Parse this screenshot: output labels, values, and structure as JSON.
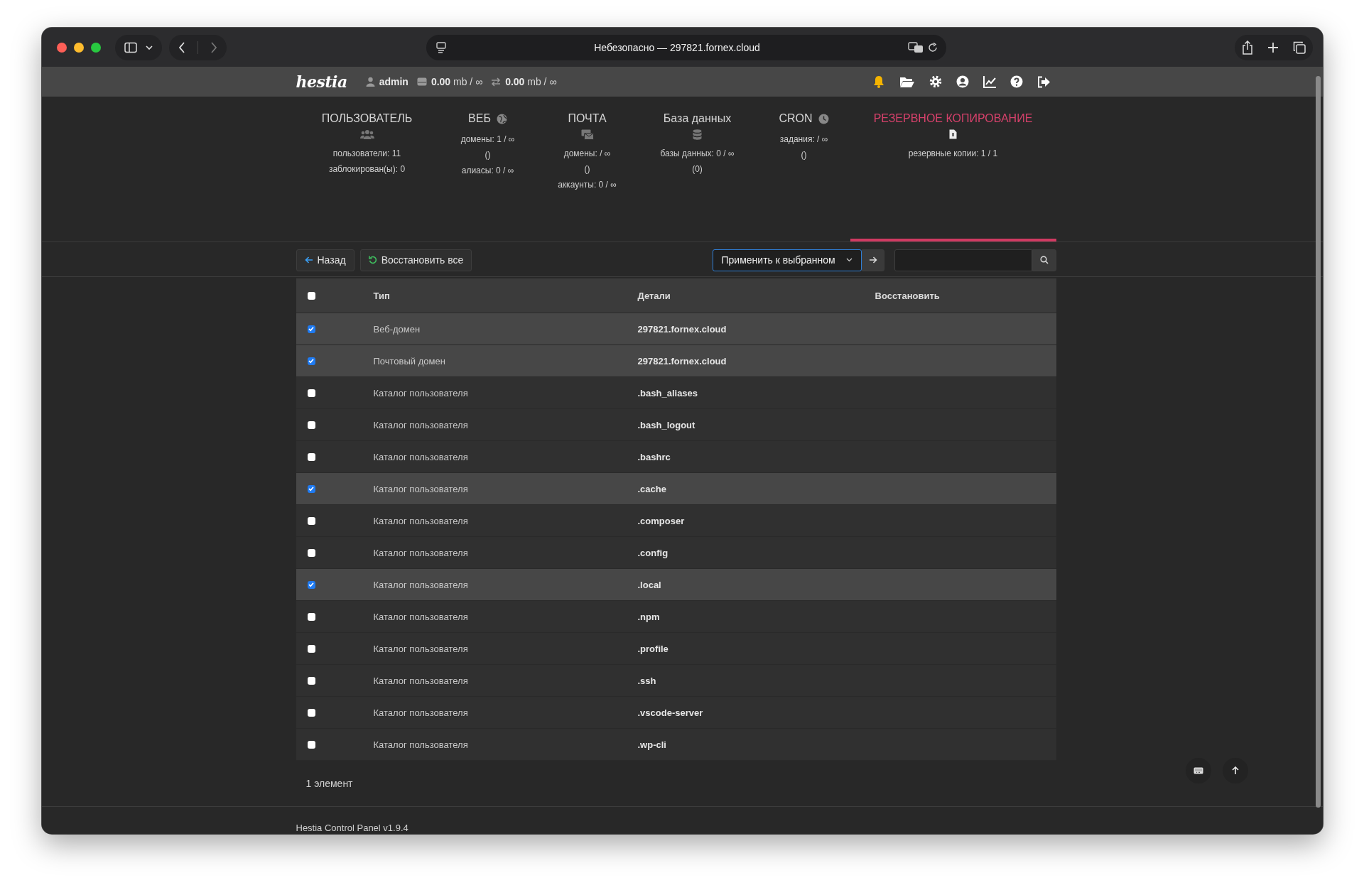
{
  "browser": {
    "address": "Небезопасно — 297821.fornex.cloud"
  },
  "topbar": {
    "logo": "hestia",
    "user": "admin",
    "disk": "**0.00** mb / ∞",
    "bandwidth": "**0.00** mb / ∞"
  },
  "stats": [
    {
      "title": "ПОЛЬЗОВАТЕЛЬ",
      "kind": "below",
      "selected": false,
      "lines": [
        "пользователи: 11",
        "заблокирован(ы): 0"
      ]
    },
    {
      "title": "ВЕБ",
      "kind": "inline",
      "selected": false,
      "lines": [
        "домены: 1 / ∞",
        "()",
        "алиасы: 0 / ∞"
      ]
    },
    {
      "title": "ПОЧТА",
      "kind": "below",
      "selected": false,
      "lines": [
        "домены: / ∞",
        "()",
        "аккаунты: 0 / ∞"
      ]
    },
    {
      "title": "База данных",
      "kind": "below",
      "selected": false,
      "lines": [
        "базы данных: 0 / ∞",
        "(0)"
      ]
    },
    {
      "title": "CRON",
      "kind": "inline",
      "selected": false,
      "lines": [
        "задания: / ∞",
        "()"
      ]
    },
    {
      "title": "РЕЗЕРВНОЕ КОПИРОВАНИЕ",
      "kind": "below",
      "selected": true,
      "lines": [
        "резервные копии: 1 / 1"
      ]
    }
  ],
  "toolbar": {
    "back": "Назад",
    "restore_all": "Восстановить все",
    "bulk_action": "Применить к выбранном"
  },
  "table": {
    "columns": [
      "Тип",
      "Детали",
      "Восстановить"
    ],
    "all_selected": false,
    "rows": [
      {
        "type": "Веб-домен",
        "details": "297821.fornex.cloud",
        "selected": true
      },
      {
        "type": "Почтовый домен",
        "details": "297821.fornex.cloud",
        "selected": true
      },
      {
        "type": "Каталог пользователя",
        "details": ".bash_aliases",
        "selected": false
      },
      {
        "type": "Каталог пользователя",
        "details": ".bash_logout",
        "selected": false
      },
      {
        "type": "Каталог пользователя",
        "details": ".bashrc",
        "selected": false
      },
      {
        "type": "Каталог пользователя",
        "details": ".cache",
        "selected": true
      },
      {
        "type": "Каталог пользователя",
        "details": ".composer",
        "selected": false
      },
      {
        "type": "Каталог пользователя",
        "details": ".config",
        "selected": false
      },
      {
        "type": "Каталог пользователя",
        "details": ".local",
        "selected": true
      },
      {
        "type": "Каталог пользователя",
        "details": ".npm",
        "selected": false
      },
      {
        "type": "Каталог пользователя",
        "details": ".profile",
        "selected": false
      },
      {
        "type": "Каталог пользователя",
        "details": ".ssh",
        "selected": false
      },
      {
        "type": "Каталог пользователя",
        "details": ".vscode-server",
        "selected": false
      },
      {
        "type": "Каталог пользователя",
        "details": ".wp-cli",
        "selected": false
      }
    ]
  },
  "count": "1 элемент",
  "footer": "Hestia Control Panel v1.9.4"
}
